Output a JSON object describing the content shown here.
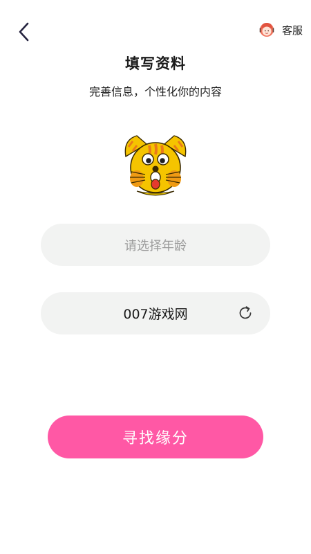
{
  "header": {
    "back_icon": "chevron-left-icon",
    "service_icon": "customer-service-icon",
    "service_label": "客服"
  },
  "main": {
    "title": "填写资料",
    "subtitle": "完善信息，个性化你的内容",
    "avatar_icon": "cartoon-cat-avatar",
    "age_field": {
      "placeholder": "请选择年龄"
    },
    "name_field": {
      "value": "007游戏网",
      "refresh_icon": "refresh-icon"
    },
    "submit_label": "寻找缘分"
  },
  "colors": {
    "accent": "#ff58a5",
    "field_bg": "#f2f3f2",
    "placeholder": "#9b9b9b"
  }
}
